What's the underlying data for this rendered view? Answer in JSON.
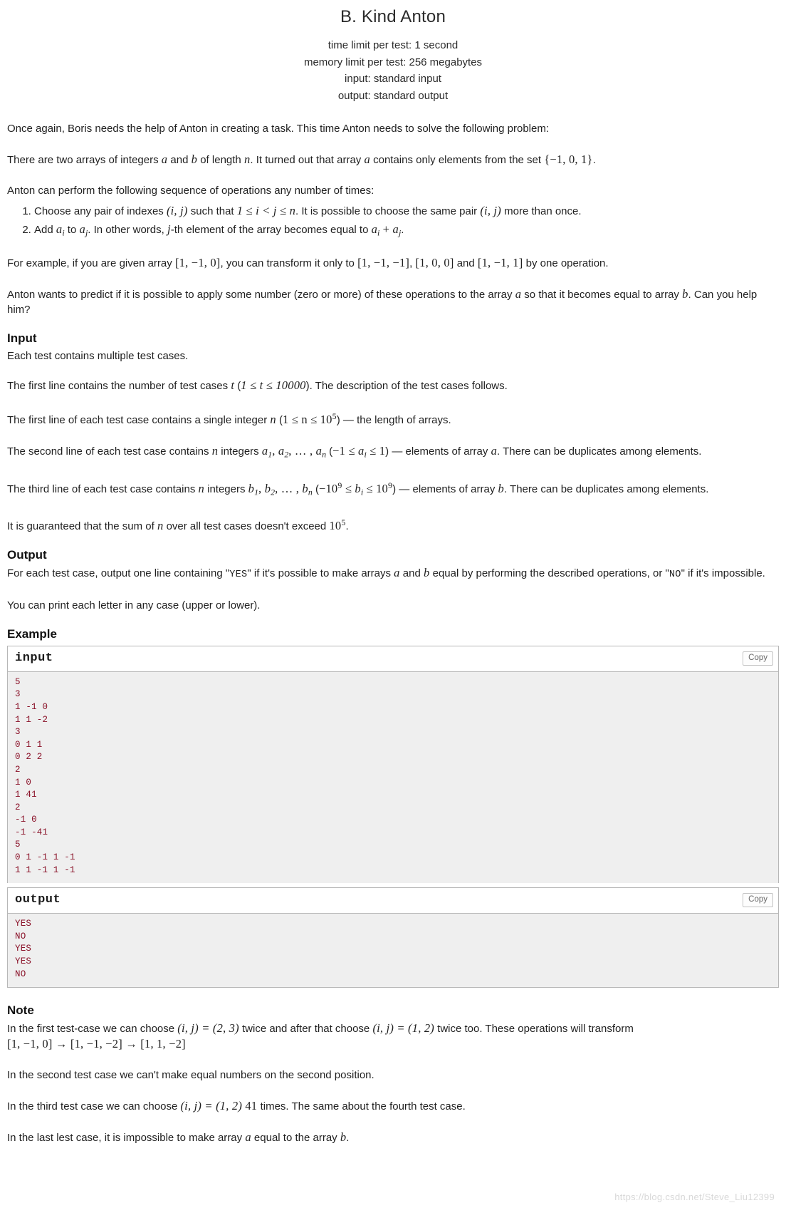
{
  "header": {
    "title": "B. Kind Anton",
    "time_limit": "time limit per test: 1 second",
    "memory_limit": "memory limit per test: 256 megabytes",
    "input_spec": "input: standard input",
    "output_spec": "output: standard output"
  },
  "statement": {
    "p1": "Once again, Boris needs the help of Anton in creating a task. This time Anton needs to solve the following problem:",
    "p2_a": "There are two arrays of integers ",
    "p2_b": " and ",
    "p2_c": " of length ",
    "p2_d": ". It turned out that array ",
    "p2_e": " contains only elements from the set ",
    "p2_set": "{−1, 0, 1}",
    "p2_end": ".",
    "p3": "Anton can perform the following sequence of operations any number of times:",
    "op1_a": "Choose any pair of indexes ",
    "op1_pair": "(i, j)",
    "op1_b": " such that ",
    "op1_cond": "1 ≤ i < j ≤ n",
    "op1_c": ". It is possible to choose the same pair ",
    "op1_pair2": "(i, j)",
    "op1_d": " more than once.",
    "op2_a": "Add ",
    "op2_ai": "a",
    "op2_b": " to ",
    "op2_aj": "a",
    "op2_c": ". In other words, ",
    "op2_j": "j",
    "op2_d": "-th element of the array becomes equal to ",
    "op2_sum": "a",
    "op2_e": ".",
    "p4_a": "For example, if you are given array ",
    "p4_arr1": "[1, −1, 0]",
    "p4_b": ", you can transform it only to ",
    "p4_arr2": "[1, −1, −1]",
    "p4_c": ", ",
    "p4_arr3": "[1, 0, 0]",
    "p4_d": " and ",
    "p4_arr4": "[1, −1, 1]",
    "p4_e": " by one operation.",
    "p5_a": "Anton wants to predict if it is possible to apply some number (zero or more) of these operations to the array ",
    "p5_b": " so that it becomes equal to array ",
    "p5_c": ". Can you help him?"
  },
  "input_section": {
    "heading": "Input",
    "p1": "Each test contains multiple test cases.",
    "p2_a": "The first line contains the number of test cases ",
    "p2_t": "t",
    "p2_b": " (",
    "p2_cond": "1 ≤ t ≤ 10000",
    "p2_c": "). The description of the test cases follows.",
    "p3_a": "The first line of each test case contains a single integer ",
    "p3_n": "n",
    "p3_b": " (",
    "p3_cond_a": "1 ≤ n ≤ 10",
    "p3_cond_exp": "5",
    "p3_c": ") — the length of arrays.",
    "p4_a": "The second line of each test case contains ",
    "p4_n": "n",
    "p4_b": " integers ",
    "p4_list": "a1, a2, …, an",
    "p4_c": " (",
    "p4_cond": "−1 ≤ ai ≤ 1",
    "p4_d": ") — elements of array ",
    "p4_e": ". There can be duplicates among elements.",
    "p5_a": "The third line of each test case contains ",
    "p5_b": " integers ",
    "p5_list": "b1, b2, …, bn",
    "p5_c": " (",
    "p5_cond": "−10^9 ≤ bi ≤ 10^9",
    "p5_d": ") — elements of array ",
    "p5_e": ". There can be duplicates among elements.",
    "p6_a": "It is guaranteed that the sum of ",
    "p6_n": "n",
    "p6_b": " over all test cases doesn't exceed ",
    "p6_val": "10",
    "p6_exp": "5",
    "p6_c": "."
  },
  "output_section": {
    "heading": "Output",
    "p1_a": "For each test case, output one line containing \"",
    "p1_yes": "YES",
    "p1_b": "\" if it's possible to make arrays ",
    "p1_c": " and ",
    "p1_d": " equal by performing the described operations, or \"",
    "p1_no": "NO",
    "p1_e": "\" if it's impossible.",
    "p2": "You can print each letter in any case (upper or lower)."
  },
  "example": {
    "heading": "Example",
    "input_label": "input",
    "output_label": "output",
    "copy_label": "Copy",
    "input_data": "5\n3\n1 -1 0\n1 1 -2\n3\n0 1 1\n0 2 2\n2\n1 0\n1 41\n2\n-1 0\n-1 -41\n5\n0 1 -1 1 -1\n1 1 -1 1 -1",
    "output_data": "YES\nNO\nYES\nYES\nNO"
  },
  "note_section": {
    "heading": "Note",
    "n1_a": "In the first test-case we can choose ",
    "n1_eq1": "(i, j) = (2, 3)",
    "n1_b": " twice and after that choose ",
    "n1_eq2": "(i, j) = (1, 2)",
    "n1_c": " twice too. These operations will transform ",
    "n1_chain": "[1, −1, 0] → [1, −1, −2] → [1, 1, −2]",
    "n2": "In the second test case we can't make equal numbers on the second position.",
    "n3_a": "In the third test case we can choose ",
    "n3_eq": "(i, j) = (1, 2)",
    "n3_b": " 41 ",
    "n3_c": "times. The same about the fourth test case.",
    "n4_a": "In the last lest case, it is impossible to make array ",
    "n4_b": " equal to the array ",
    "n4_c": "."
  },
  "watermark": {
    "text": "https://blog.csdn.net/Steve_Liu12399"
  },
  "symbols": {
    "a": "a",
    "b": "b",
    "n": "n"
  }
}
